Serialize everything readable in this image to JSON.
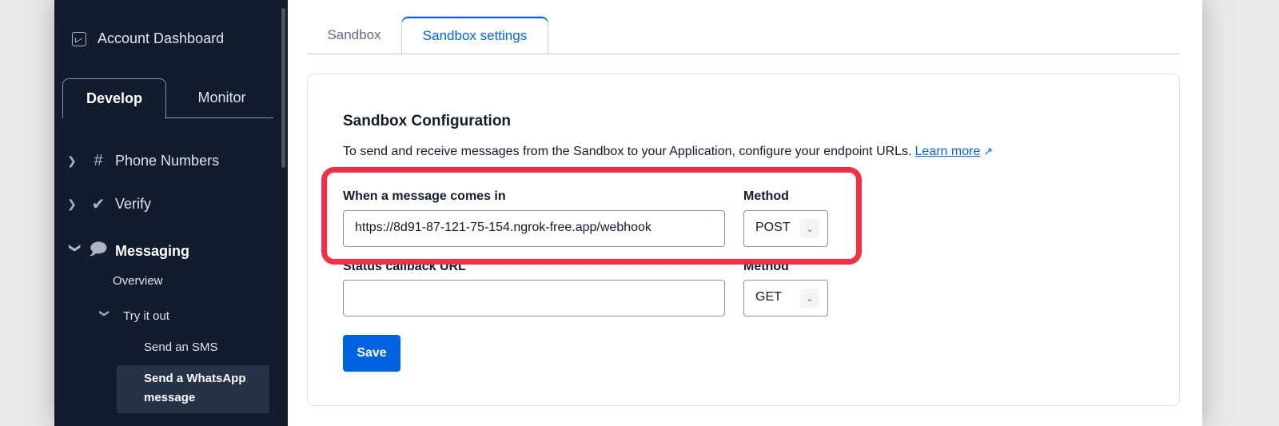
{
  "sidebar": {
    "account_dashboard": "Account Dashboard",
    "tabs": {
      "develop": "Develop",
      "monitor": "Monitor"
    },
    "items": [
      {
        "label": "Phone Numbers",
        "icon": "hash-icon"
      },
      {
        "label": "Verify",
        "icon": "verify-check-icon"
      },
      {
        "label": "Messaging",
        "icon": "chat-bubble-icon"
      }
    ],
    "overview": "Overview",
    "try_it_out": "Try it out",
    "send_sms": "Send an SMS",
    "send_whatsapp": "Send a WhatsApp message"
  },
  "tabs": {
    "sandbox": "Sandbox",
    "sandbox_settings": "Sandbox settings"
  },
  "config": {
    "title": "Sandbox Configuration",
    "description": "To send and receive messages from the Sandbox to your Application, configure your endpoint URLs.",
    "learn_more": "Learn more",
    "message_label": "When a message comes in",
    "message_url": "https://8d91-87-121-75-154.ngrok-free.app/webhook",
    "method_label": "Method",
    "message_method": "POST",
    "status_label": "Status callback URL",
    "status_url": "",
    "status_method_label": "Method",
    "status_method": "GET",
    "save": "Save"
  },
  "colors": {
    "accent": "#0263e0",
    "highlight": "#f22f46",
    "sidebar": "#121c2d"
  }
}
